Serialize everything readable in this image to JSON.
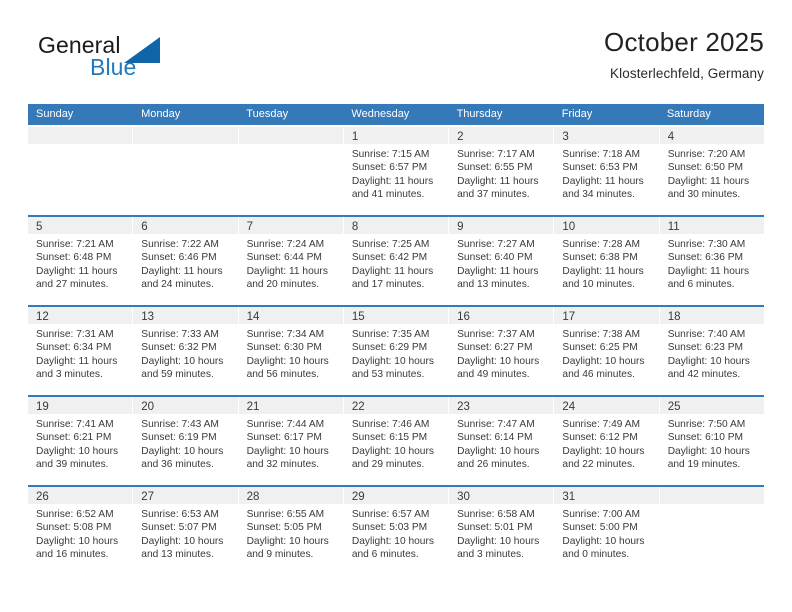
{
  "brand": {
    "name_part1": "General",
    "name_part2": "Blue",
    "logo_icon": "triangle-logo-icon",
    "accent_color": "#2179bf"
  },
  "header": {
    "title": "October 2025",
    "subtitle": "Klosterlechfeld, Germany"
  },
  "calendar": {
    "header_bg": "#3579b8",
    "weekdays": [
      "Sunday",
      "Monday",
      "Tuesday",
      "Wednesday",
      "Thursday",
      "Friday",
      "Saturday"
    ],
    "weeks": [
      [
        {
          "day": "",
          "empty": true
        },
        {
          "day": "",
          "empty": true
        },
        {
          "day": "",
          "empty": true
        },
        {
          "day": "1",
          "sunrise": "Sunrise: 7:15 AM",
          "sunset": "Sunset: 6:57 PM",
          "daylight1": "Daylight: 11 hours",
          "daylight2": "and 41 minutes."
        },
        {
          "day": "2",
          "sunrise": "Sunrise: 7:17 AM",
          "sunset": "Sunset: 6:55 PM",
          "daylight1": "Daylight: 11 hours",
          "daylight2": "and 37 minutes."
        },
        {
          "day": "3",
          "sunrise": "Sunrise: 7:18 AM",
          "sunset": "Sunset: 6:53 PM",
          "daylight1": "Daylight: 11 hours",
          "daylight2": "and 34 minutes."
        },
        {
          "day": "4",
          "sunrise": "Sunrise: 7:20 AM",
          "sunset": "Sunset: 6:50 PM",
          "daylight1": "Daylight: 11 hours",
          "daylight2": "and 30 minutes."
        }
      ],
      [
        {
          "day": "5",
          "sunrise": "Sunrise: 7:21 AM",
          "sunset": "Sunset: 6:48 PM",
          "daylight1": "Daylight: 11 hours",
          "daylight2": "and 27 minutes."
        },
        {
          "day": "6",
          "sunrise": "Sunrise: 7:22 AM",
          "sunset": "Sunset: 6:46 PM",
          "daylight1": "Daylight: 11 hours",
          "daylight2": "and 24 minutes."
        },
        {
          "day": "7",
          "sunrise": "Sunrise: 7:24 AM",
          "sunset": "Sunset: 6:44 PM",
          "daylight1": "Daylight: 11 hours",
          "daylight2": "and 20 minutes."
        },
        {
          "day": "8",
          "sunrise": "Sunrise: 7:25 AM",
          "sunset": "Sunset: 6:42 PM",
          "daylight1": "Daylight: 11 hours",
          "daylight2": "and 17 minutes."
        },
        {
          "day": "9",
          "sunrise": "Sunrise: 7:27 AM",
          "sunset": "Sunset: 6:40 PM",
          "daylight1": "Daylight: 11 hours",
          "daylight2": "and 13 minutes."
        },
        {
          "day": "10",
          "sunrise": "Sunrise: 7:28 AM",
          "sunset": "Sunset: 6:38 PM",
          "daylight1": "Daylight: 11 hours",
          "daylight2": "and 10 minutes."
        },
        {
          "day": "11",
          "sunrise": "Sunrise: 7:30 AM",
          "sunset": "Sunset: 6:36 PM",
          "daylight1": "Daylight: 11 hours",
          "daylight2": "and 6 minutes."
        }
      ],
      [
        {
          "day": "12",
          "sunrise": "Sunrise: 7:31 AM",
          "sunset": "Sunset: 6:34 PM",
          "daylight1": "Daylight: 11 hours",
          "daylight2": "and 3 minutes."
        },
        {
          "day": "13",
          "sunrise": "Sunrise: 7:33 AM",
          "sunset": "Sunset: 6:32 PM",
          "daylight1": "Daylight: 10 hours",
          "daylight2": "and 59 minutes."
        },
        {
          "day": "14",
          "sunrise": "Sunrise: 7:34 AM",
          "sunset": "Sunset: 6:30 PM",
          "daylight1": "Daylight: 10 hours",
          "daylight2": "and 56 minutes."
        },
        {
          "day": "15",
          "sunrise": "Sunrise: 7:35 AM",
          "sunset": "Sunset: 6:29 PM",
          "daylight1": "Daylight: 10 hours",
          "daylight2": "and 53 minutes."
        },
        {
          "day": "16",
          "sunrise": "Sunrise: 7:37 AM",
          "sunset": "Sunset: 6:27 PM",
          "daylight1": "Daylight: 10 hours",
          "daylight2": "and 49 minutes."
        },
        {
          "day": "17",
          "sunrise": "Sunrise: 7:38 AM",
          "sunset": "Sunset: 6:25 PM",
          "daylight1": "Daylight: 10 hours",
          "daylight2": "and 46 minutes."
        },
        {
          "day": "18",
          "sunrise": "Sunrise: 7:40 AM",
          "sunset": "Sunset: 6:23 PM",
          "daylight1": "Daylight: 10 hours",
          "daylight2": "and 42 minutes."
        }
      ],
      [
        {
          "day": "19",
          "sunrise": "Sunrise: 7:41 AM",
          "sunset": "Sunset: 6:21 PM",
          "daylight1": "Daylight: 10 hours",
          "daylight2": "and 39 minutes."
        },
        {
          "day": "20",
          "sunrise": "Sunrise: 7:43 AM",
          "sunset": "Sunset: 6:19 PM",
          "daylight1": "Daylight: 10 hours",
          "daylight2": "and 36 minutes."
        },
        {
          "day": "21",
          "sunrise": "Sunrise: 7:44 AM",
          "sunset": "Sunset: 6:17 PM",
          "daylight1": "Daylight: 10 hours",
          "daylight2": "and 32 minutes."
        },
        {
          "day": "22",
          "sunrise": "Sunrise: 7:46 AM",
          "sunset": "Sunset: 6:15 PM",
          "daylight1": "Daylight: 10 hours",
          "daylight2": "and 29 minutes."
        },
        {
          "day": "23",
          "sunrise": "Sunrise: 7:47 AM",
          "sunset": "Sunset: 6:14 PM",
          "daylight1": "Daylight: 10 hours",
          "daylight2": "and 26 minutes."
        },
        {
          "day": "24",
          "sunrise": "Sunrise: 7:49 AM",
          "sunset": "Sunset: 6:12 PM",
          "daylight1": "Daylight: 10 hours",
          "daylight2": "and 22 minutes."
        },
        {
          "day": "25",
          "sunrise": "Sunrise: 7:50 AM",
          "sunset": "Sunset: 6:10 PM",
          "daylight1": "Daylight: 10 hours",
          "daylight2": "and 19 minutes."
        }
      ],
      [
        {
          "day": "26",
          "sunrise": "Sunrise: 6:52 AM",
          "sunset": "Sunset: 5:08 PM",
          "daylight1": "Daylight: 10 hours",
          "daylight2": "and 16 minutes."
        },
        {
          "day": "27",
          "sunrise": "Sunrise: 6:53 AM",
          "sunset": "Sunset: 5:07 PM",
          "daylight1": "Daylight: 10 hours",
          "daylight2": "and 13 minutes."
        },
        {
          "day": "28",
          "sunrise": "Sunrise: 6:55 AM",
          "sunset": "Sunset: 5:05 PM",
          "daylight1": "Daylight: 10 hours",
          "daylight2": "and 9 minutes."
        },
        {
          "day": "29",
          "sunrise": "Sunrise: 6:57 AM",
          "sunset": "Sunset: 5:03 PM",
          "daylight1": "Daylight: 10 hours",
          "daylight2": "and 6 minutes."
        },
        {
          "day": "30",
          "sunrise": "Sunrise: 6:58 AM",
          "sunset": "Sunset: 5:01 PM",
          "daylight1": "Daylight: 10 hours",
          "daylight2": "and 3 minutes."
        },
        {
          "day": "31",
          "sunrise": "Sunrise: 7:00 AM",
          "sunset": "Sunset: 5:00 PM",
          "daylight1": "Daylight: 10 hours",
          "daylight2": "and 0 minutes."
        },
        {
          "day": "",
          "empty": true
        }
      ]
    ]
  }
}
